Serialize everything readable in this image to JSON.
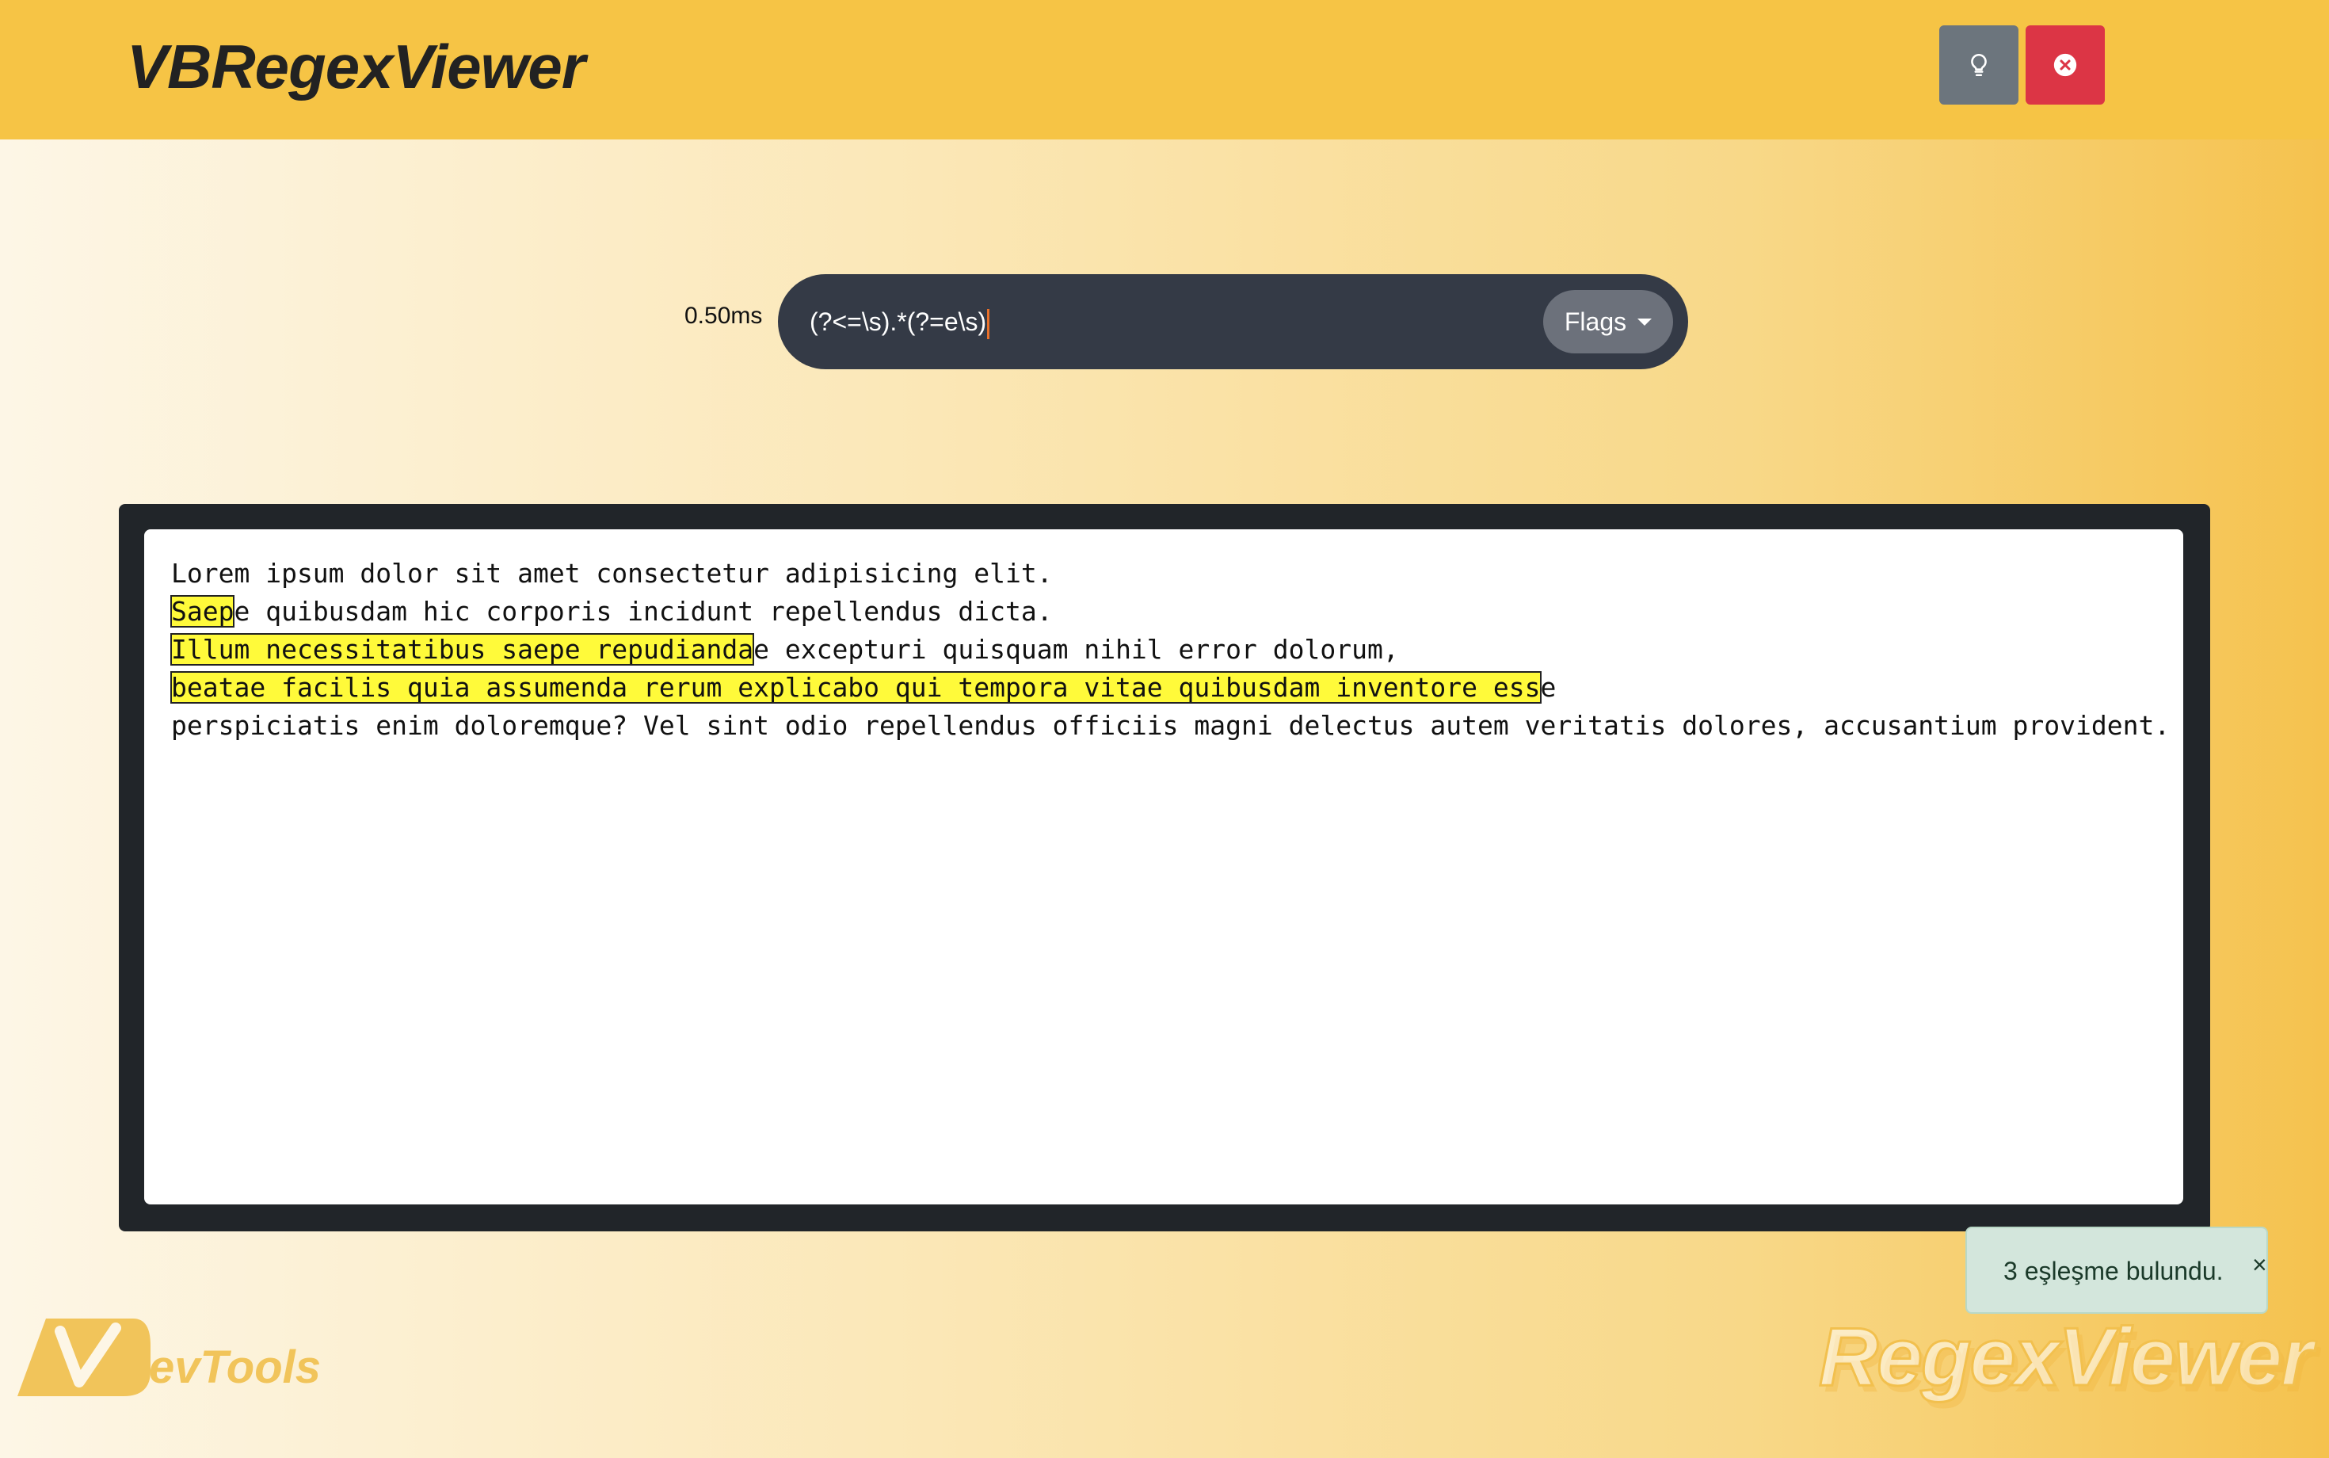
{
  "header": {
    "title": "VBRegexViewer",
    "theme_icon": "lightbulb-icon",
    "close_icon": "close-circle-icon"
  },
  "search": {
    "timing": "0.50ms",
    "pattern": "(?<=\\s).*(?=e\\s)",
    "flags_label": "Flags"
  },
  "text": {
    "lines": [
      [
        {
          "t": "Lorem ipsum dolor sit amet consectetur adipisicing elit.",
          "m": false
        }
      ],
      [
        {
          "t": "Saep",
          "m": true
        },
        {
          "t": "e quibusdam hic corporis incidunt repellendus dicta.",
          "m": false
        }
      ],
      [
        {
          "t": "Illum necessitatibus saepe repudianda",
          "m": true
        },
        {
          "t": "e excepturi quisquam nihil error dolorum,",
          "m": false
        }
      ],
      [
        {
          "t": "beatae facilis quia assumenda rerum explicabo qui tempora vitae quibusdam inventore ess",
          "m": true
        },
        {
          "t": "e",
          "m": false
        }
      ],
      [
        {
          "t": "perspiciatis enim doloremque? Vel sint odio repellendus officiis magni delectus autem veritatis dolores, accusantium provident.",
          "m": false
        }
      ]
    ]
  },
  "toast": {
    "message": "3 eşleşme bulundu.",
    "close": "×"
  },
  "footer": {
    "devtools_label": "evTools",
    "watermark": "RegexViewer"
  },
  "colors": {
    "header_bg": "#f6c445",
    "panel_bg": "#212529",
    "match_highlight": "#fffa3a",
    "toast_bg": "#d3e6dc",
    "danger": "#dc3545",
    "secondary": "#6c757d"
  }
}
